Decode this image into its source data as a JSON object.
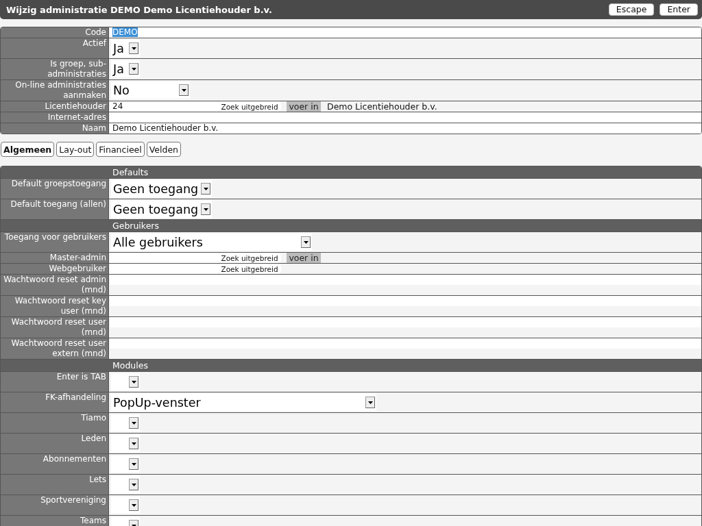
{
  "window": {
    "title": "Wijzig administratie DEMO Demo Licentiehouder b.v.",
    "buttons": [
      "Escape",
      "Enter"
    ]
  },
  "main_fields": [
    {
      "kind": "text",
      "label": "Code",
      "value": "DEMO",
      "highlighted": true
    },
    {
      "kind": "select",
      "label": "Actief",
      "value": "Ja"
    },
    {
      "kind": "select",
      "label": "Is groep, sub-administraties",
      "value": "Ja"
    },
    {
      "kind": "select",
      "label": "On-line administraties aanmaken",
      "value": "No"
    },
    {
      "kind": "lookup",
      "label": "Licentiehouder",
      "value": "24",
      "search_button": "Zoek uitgebreid",
      "enter_button": "voer in",
      "display": "Demo Licentiehouder b.v."
    },
    {
      "kind": "text",
      "label": "Internet-adres"
    },
    {
      "kind": "text",
      "label": "Naam",
      "value": "Demo Licentiehouder b.v."
    }
  ],
  "tabs": [
    {
      "label": "Algemeen",
      "selected": true
    },
    {
      "label": "Lay-out",
      "selected": false
    },
    {
      "label": "Financieel",
      "selected": false
    },
    {
      "label": "Velden",
      "selected": false
    }
  ],
  "sections": [
    {
      "title": "Defaults",
      "fields": [
        {
          "kind": "select",
          "label": "Default groepstoegang",
          "value": "Geen toegang"
        },
        {
          "kind": "select",
          "label": "Default toegang (allen)",
          "value": "Geen toegang"
        }
      ]
    },
    {
      "title": "Gebruikers",
      "fields": [
        {
          "kind": "select",
          "label": "Toegang voor gebruikers",
          "value": "Alle gebruikers"
        },
        {
          "kind": "lookup",
          "label": "Master-admin",
          "search_button": "Zoek uitgebreid",
          "enter_button": "voer in"
        },
        {
          "kind": "lookup",
          "label": "Webgebruiker",
          "search_button": "Zoek uitgebreid"
        },
        {
          "kind": "text",
          "label": "Wachtwoord reset admin (mnd)"
        },
        {
          "kind": "text",
          "label": "Wachtwoord reset key user (mnd)"
        },
        {
          "kind": "text",
          "label": "Wachtwoord reset user (mnd)"
        },
        {
          "kind": "text",
          "label": "Wachtwoord reset user extern (mnd)"
        }
      ]
    },
    {
      "title": "Modules",
      "fields": [
        {
          "kind": "select",
          "label": "Enter is TAB"
        },
        {
          "kind": "select",
          "label": "FK-afhandeling",
          "value": "PopUp-venster"
        },
        {
          "kind": "select",
          "label": "Tiamo"
        },
        {
          "kind": "select",
          "label": "Leden"
        },
        {
          "kind": "select",
          "label": "Abonnementen"
        },
        {
          "kind": "select",
          "label": "Lets"
        },
        {
          "kind": "select",
          "label": "Sportvereniging"
        },
        {
          "kind": "select",
          "label": "Teams"
        }
      ]
    }
  ]
}
